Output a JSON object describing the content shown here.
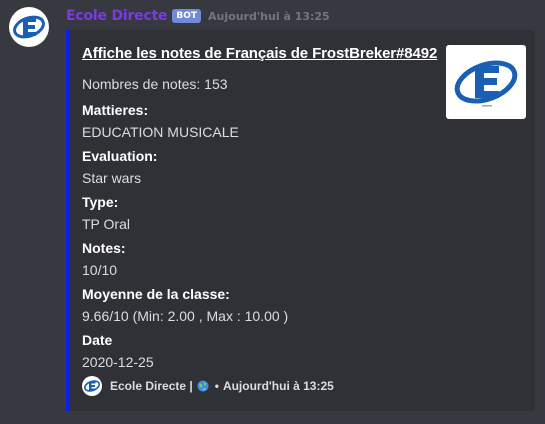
{
  "message": {
    "author": "Ecole Directe",
    "bot_tag": "BOT",
    "timestamp": "Aujourd'hui à 13:25"
  },
  "embed": {
    "accent_color": "#0a1ef2",
    "title": "Affiche les notes de Français de FrostBreker#8492",
    "description": "Nombres de notes: 153",
    "fields": [
      {
        "name": "Mattieres:",
        "value": "EDUCATION MUSICALE"
      },
      {
        "name": "Evaluation:",
        "value": "Star wars"
      },
      {
        "name": "Type:",
        "value": "TP Oral"
      },
      {
        "name": "Notes:",
        "value": "10/10"
      },
      {
        "name": "Moyenne de la classe:",
        "value": "9.66/10 (Min: 2.00 , Max : 10.00 )"
      },
      {
        "name": "Date",
        "value": "2020-12-25"
      }
    ],
    "footer": {
      "text": "Ecole Directe |",
      "separator": "•",
      "timestamp": "Aujourd'hui à 13:25"
    }
  },
  "icons": {
    "avatar": "ecole-directe-logo",
    "thumbnail": "ecole-directe-logo",
    "footer_icon": "ecole-directe-logo",
    "globe": "globe-icon"
  }
}
